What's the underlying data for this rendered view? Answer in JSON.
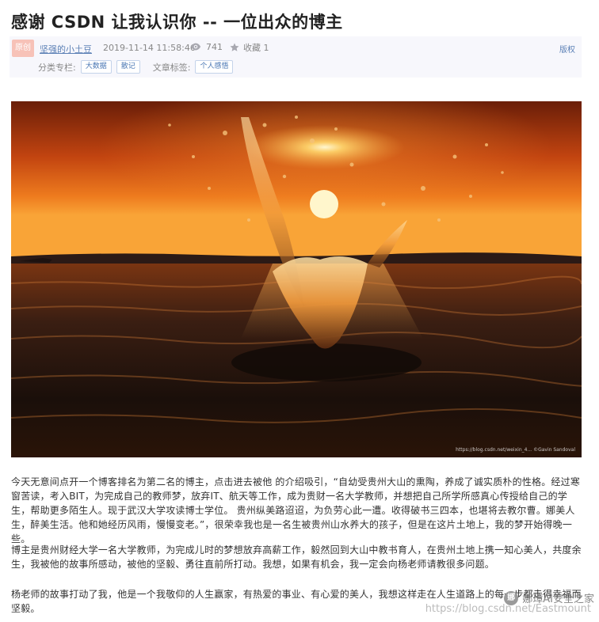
{
  "article": {
    "title": "感谢 CSDN 让我认识你 -- 一位出众的博主"
  },
  "meta": {
    "badge": "原创",
    "author": "坚强的小土豆",
    "date": "2019-11-14 11:58:46",
    "views": "741",
    "favorites": "收藏 1",
    "copyright": "版权",
    "category_label": "分类专栏:",
    "categories": [
      "大数据",
      "散记"
    ],
    "tags_label": "文章标签:",
    "tags": [
      "个人感悟"
    ]
  },
  "hero_image": {
    "watermark": "https://blog.csdn.net/weixin_4... ©Gavin Sandoval"
  },
  "body": {
    "paragraphs": [
      "今天无意间点开一个博客排名为第二名的博主，点击进去被他 的介绍吸引，“自幼受贵州大山的熏陶，养成了诚实质朴的性格。经过寒窗苦读，考入BIT，为完成自己的教师梦，放弃IT、航天等工作，成为贵财一名大学教师，并想把自己所学所感真心传授给自己的学生，帮助更多陌生人。现于武汉大学攻读博士学位。 贵州纵美路迢迢，为负劳心此一遭。收得破书三四本，也堪将去教尔曹。娜美人生，醉美生活。他和她经历风雨，慢慢变老。”，很荣幸我也是一名生被贵州山水养大的孩子，但是在这片土地上，我的梦开始得晚一些。",
      "博主是贵州财经大学一名大学教师，为完成儿时的梦想放弃高薪工作，毅然回到大山中教书育人，在贵州土地上携一知心美人，共度余生，我被他的故事所感动，被他的坚毅、勇往直前所打动。我想，如果有机会，我一定会向杨老师请教很多问题。",
      "杨老师的故事打动了我，他是一个我敬仰的人生赢家，有热爱的事业、有心爱的美人，我想这样走在人生道路上的每一步都走得幸福而坚毅。"
    ]
  },
  "watermarks": {
    "site": "娜璋AI安全之家",
    "site_logo": "娜",
    "csdn": "https://blog.csdn.net/Eastmount"
  },
  "colors": {
    "link": "#5a7fb5",
    "meta_bg": "#f7f7fc",
    "badge_bg": "#f7c2b8"
  }
}
